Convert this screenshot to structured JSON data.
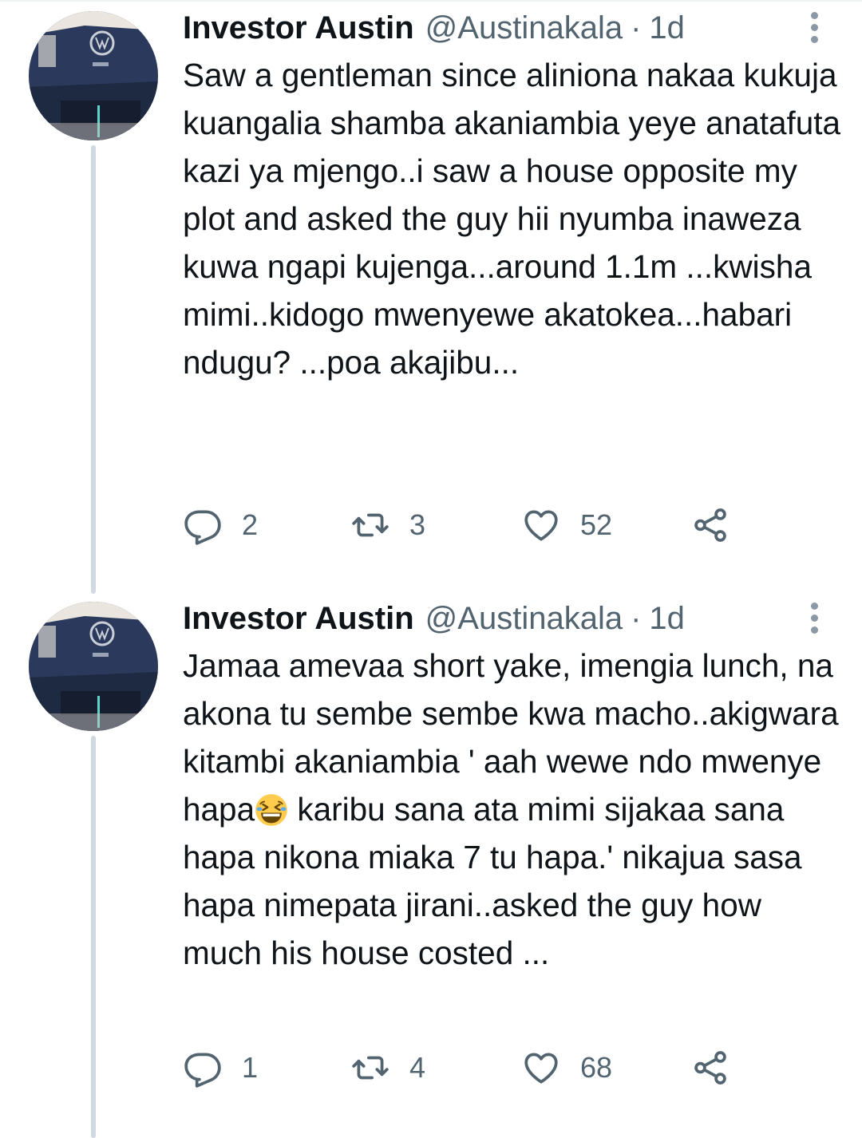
{
  "tweets": [
    {
      "author_name": "Investor Austin",
      "handle": "@Austinakala",
      "separator": "·",
      "time": "1d",
      "text": "Saw a gentleman since aliniona nakaa kukuja kuangalia shamba akaniambia yeye anatafuta kazi ya mjengo..i saw a house opposite my plot and asked the guy hii nyumba inaweza kuwa ngapi kujenga...around 1.1m ...kwisha mimi..kidogo mwenyewe akatokea...habari ndugu? ...poa akajibu...",
      "replies": "2",
      "retweets": "3",
      "likes": "52"
    },
    {
      "author_name": "Investor Austin",
      "handle": "@Austinakala",
      "separator": "·",
      "time": "1d",
      "text_before_emoji": "Jamaa amevaa short yake, imengia lunch, na akona tu sembe sembe kwa macho..akigwara kitambi akaniambia ' aah wewe ndo mwenye hapa",
      "emoji": "grinning-squinting-face",
      "text_after_emoji": " karibu sana ata mimi sijakaa sana hapa nikona miaka 7 tu hapa.' nikajua sasa hapa nimepata jirani..asked the guy how much his house costed ...",
      "replies": "1",
      "retweets": "4",
      "likes": "68"
    }
  ],
  "icons": {
    "reply": "reply-icon",
    "retweet": "retweet-icon",
    "like": "heart-icon",
    "share": "share-icon",
    "more": "more-options-icon"
  },
  "colors": {
    "text": "#0f1419",
    "secondary": "#536471",
    "thread_line": "#cfd9de",
    "avatar_bg": "#2a3756"
  }
}
